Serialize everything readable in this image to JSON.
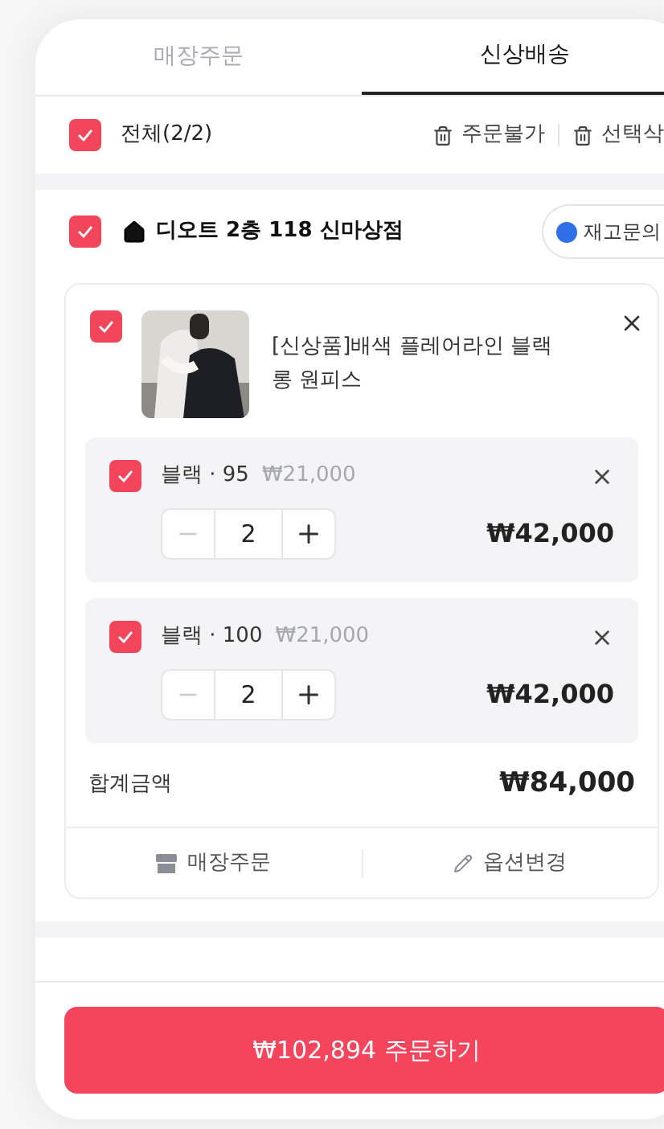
{
  "tabs": [
    {
      "label": "매장주문",
      "selected": false
    },
    {
      "label": "신상배송",
      "selected": true
    }
  ],
  "select_all": {
    "label": "전체(2/2)",
    "checked": true
  },
  "actions": [
    "주문불가",
    "선택삭"
  ],
  "store": {
    "checked": true,
    "name": "디오트 2층 118 신마상점",
    "stock_inquiry": "재고문의"
  },
  "product": {
    "checked": true,
    "title": "[신상품]배색 플레어라인 블랙 롱 원피스"
  },
  "options": [
    {
      "checked": true,
      "label": "블랙 · 95",
      "unit_price": "₩21,000",
      "quantity": "2",
      "price": "₩42,000"
    },
    {
      "checked": true,
      "label": "블랙 · 100",
      "unit_price": "₩21,000",
      "quantity": "2",
      "price": "₩42,000"
    }
  ],
  "total": {
    "label": "합계금액",
    "value": "₩84,000"
  },
  "footer_buttons": [
    {
      "kind": "store",
      "label": "매장주문"
    },
    {
      "kind": "edit",
      "label": "옵션변경"
    }
  ],
  "order_button": "₩102,894 주문하기"
}
